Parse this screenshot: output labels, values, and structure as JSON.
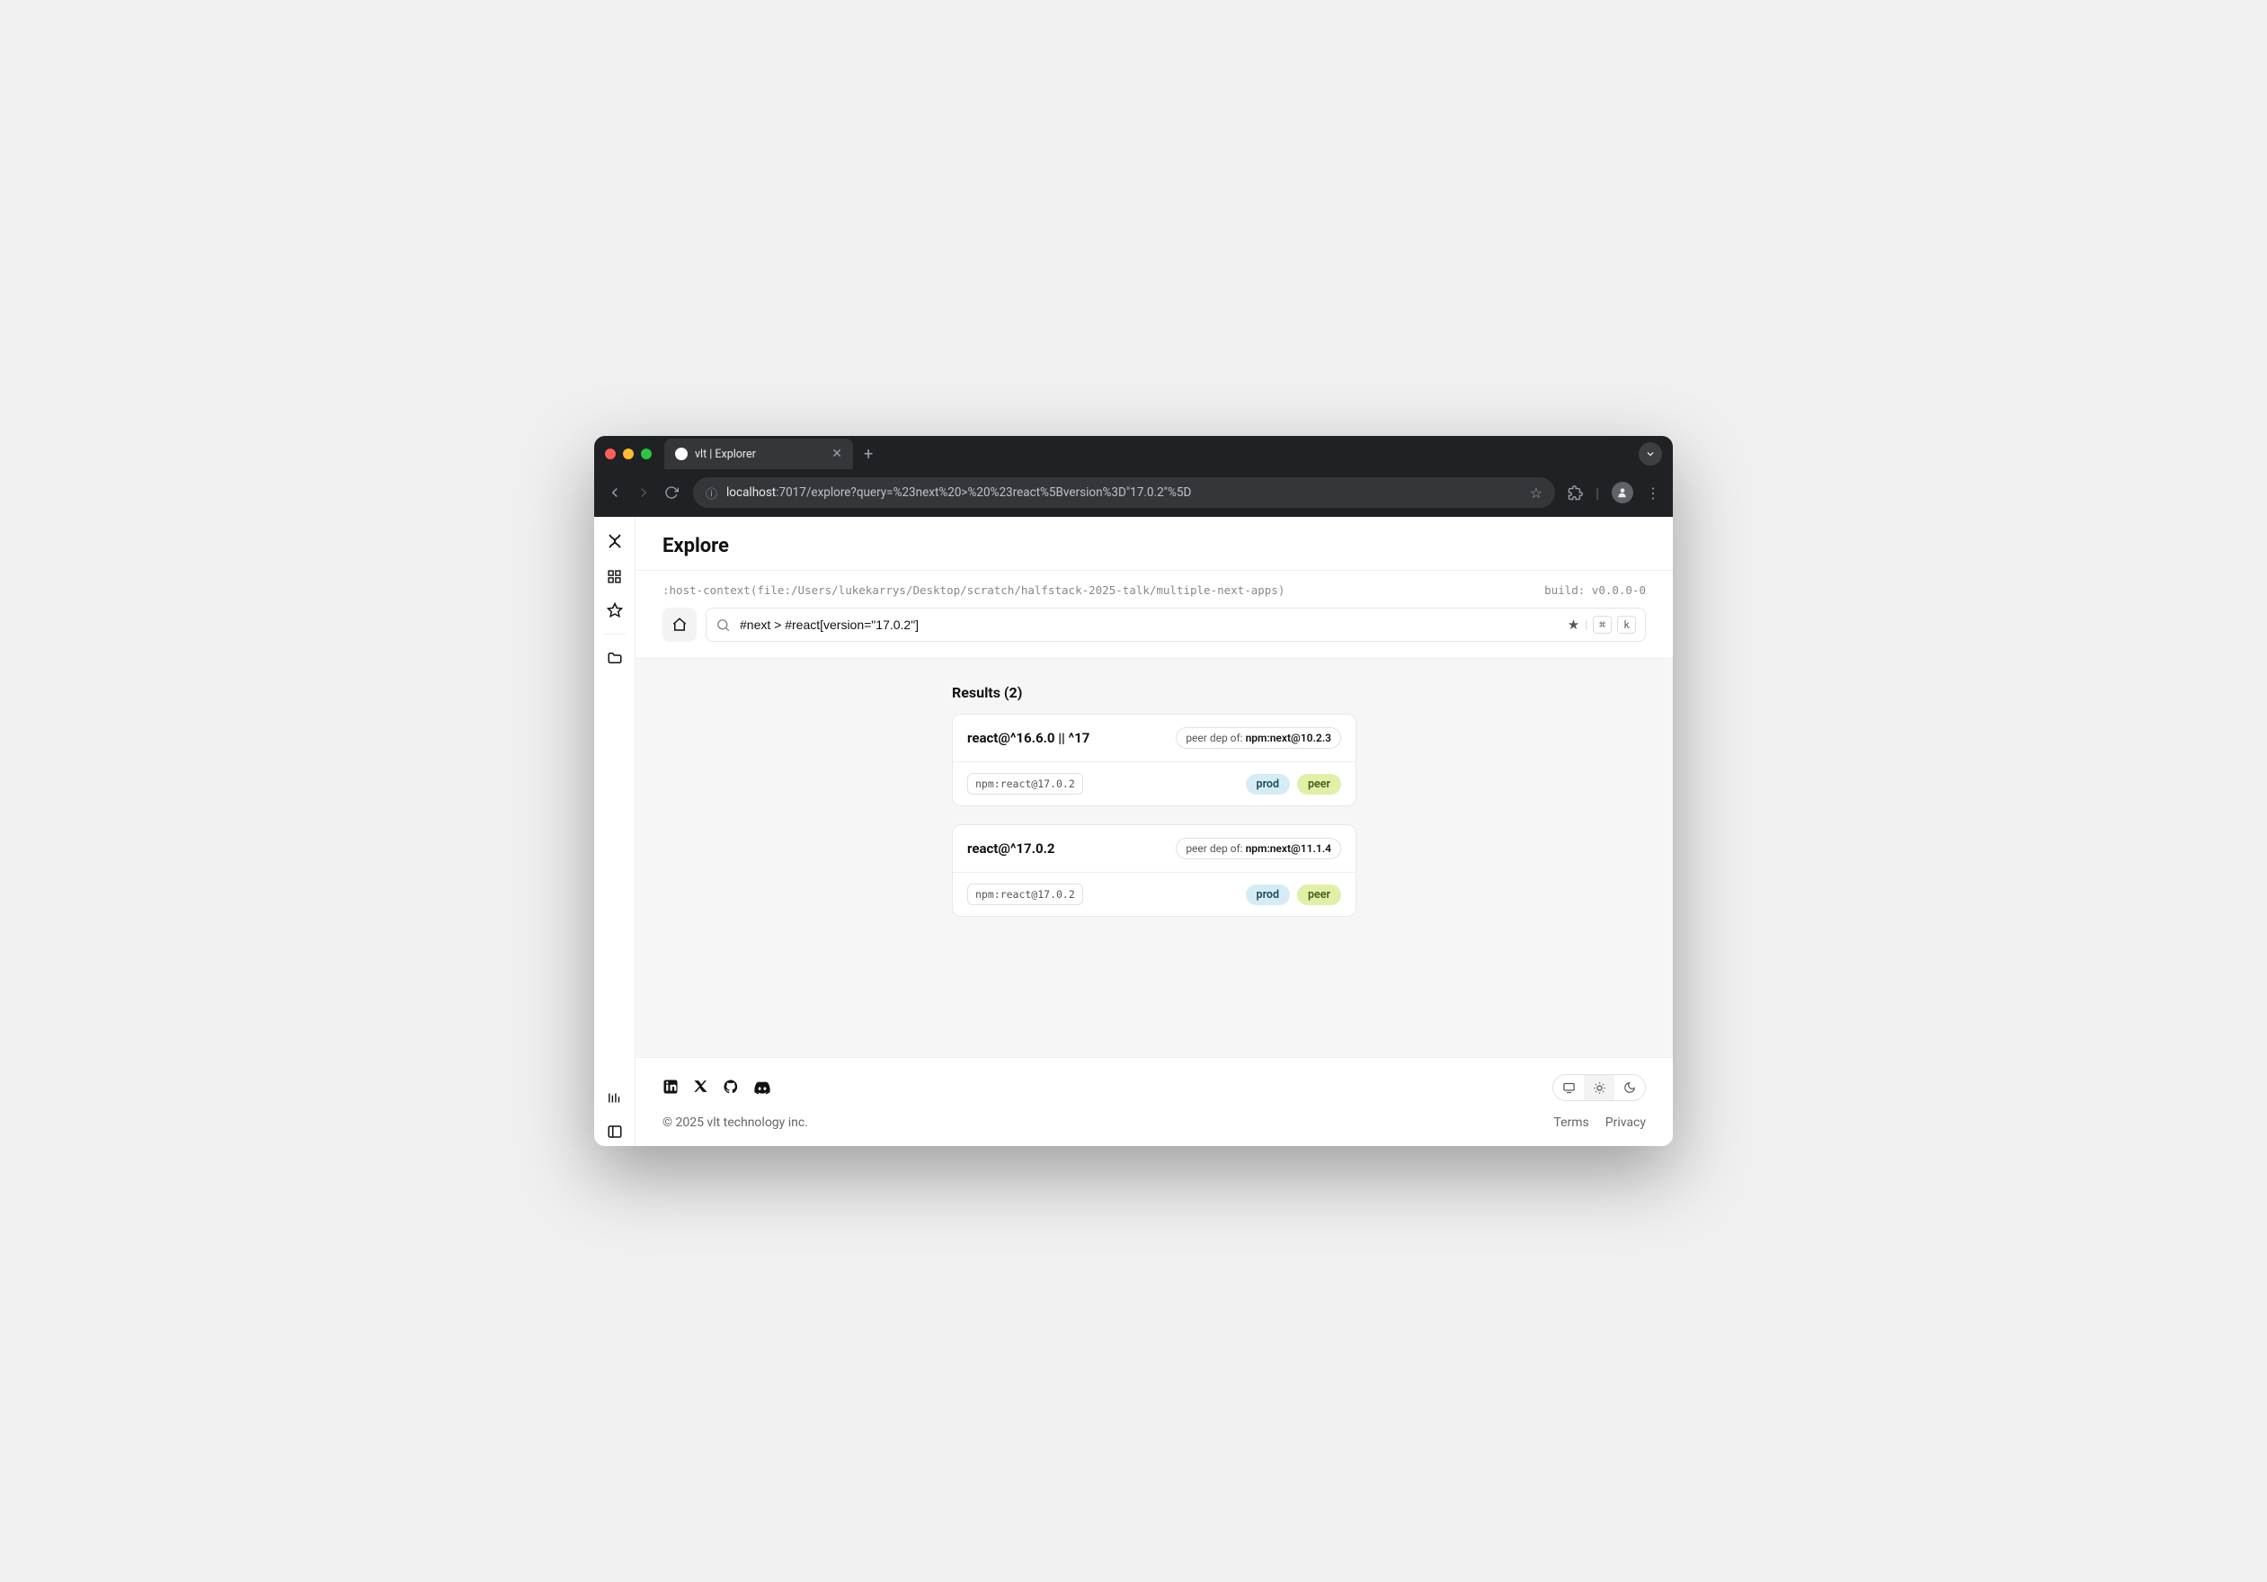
{
  "browser": {
    "tab_title": "vlt | Explorer",
    "url_host": "localhost",
    "url_rest": ":7017/explore?query=%23next%20>%20%23react%5Bversion%3D\"17.0.2\"%5D"
  },
  "header": {
    "title": "Explore"
  },
  "context": {
    "host": ":host-context(file:/Users/lukekarrys/Desktop/scratch/halfstack-2025-talk/multiple-next-apps)",
    "build": "build: v0.0.0-0"
  },
  "search": {
    "query": "#next > #react[version=\"17.0.2\"]",
    "kbd_cmd": "⌘",
    "kbd_k": "k"
  },
  "results": {
    "title": "Results (2)",
    "items": [
      {
        "title": "react@^16.6.0 || ^17",
        "peer_label": "peer dep of:",
        "peer_value": "npm:next@10.2.3",
        "spec": "npm:react@17.0.2",
        "tags": [
          "prod",
          "peer"
        ]
      },
      {
        "title": "react@^17.0.2",
        "peer_label": "peer dep of:",
        "peer_value": "npm:next@11.1.4",
        "spec": "npm:react@17.0.2",
        "tags": [
          "prod",
          "peer"
        ]
      }
    ]
  },
  "footer": {
    "copyright": "© 2025 vlt technology inc.",
    "links": [
      "Terms",
      "Privacy"
    ]
  }
}
